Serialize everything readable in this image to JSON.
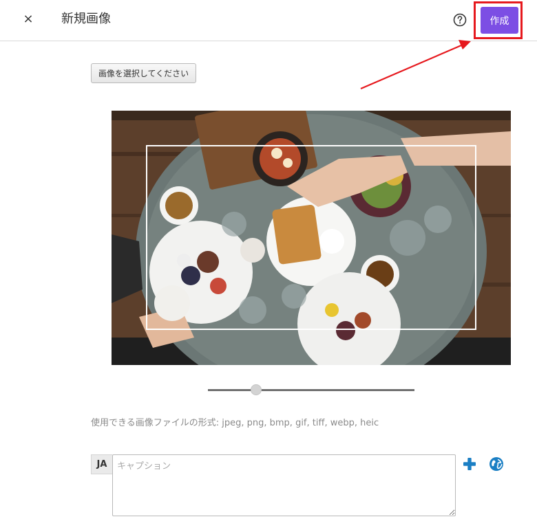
{
  "header": {
    "close_label": "×",
    "title": "新規画像",
    "create_label": "作成"
  },
  "uploader": {
    "select_label": "画像を選択してください",
    "zoom_value": 0.22,
    "formats_text": "使用できる画像ファイルの形式: jpeg, png, bmp, gif, tiff, webp, heic"
  },
  "caption": {
    "lang": "JA",
    "placeholder": "キャプション",
    "value": ""
  },
  "icons": {
    "close": "close-icon",
    "help": "help-circle-icon",
    "add": "plus-icon",
    "globe": "globe-icon"
  },
  "colors": {
    "primary": "#7c4ee4",
    "highlight": "#e6191e",
    "plus": "#1b7fc4"
  }
}
